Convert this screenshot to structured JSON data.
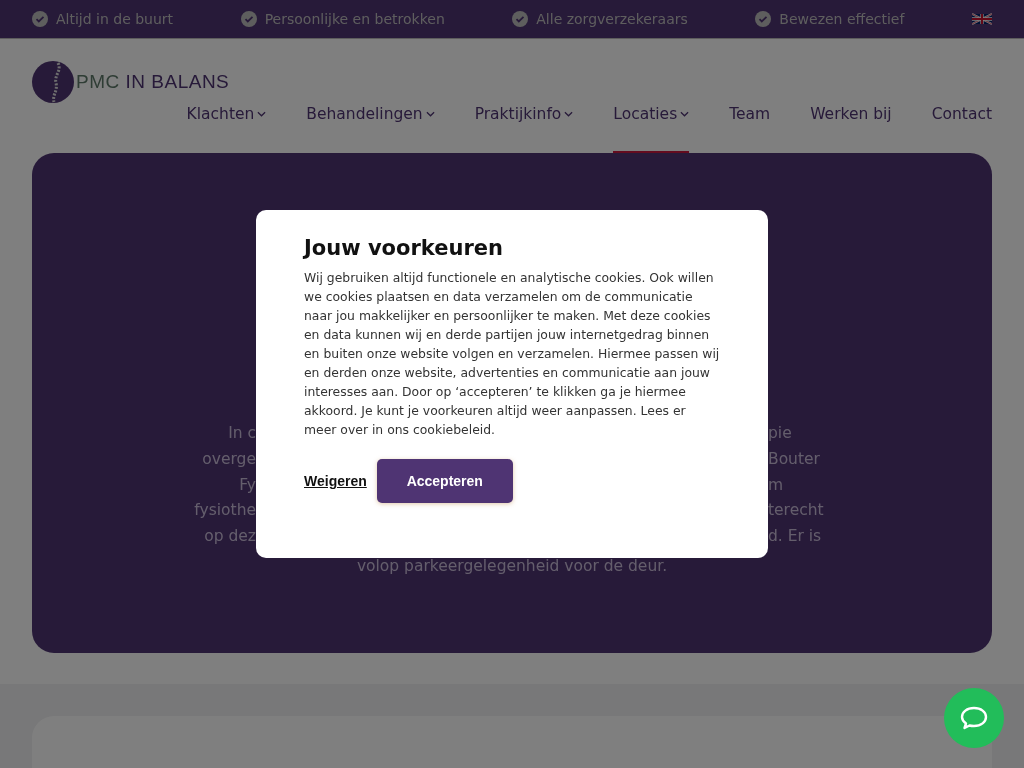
{
  "top_bar": {
    "usps": [
      "Altijd in de buurt",
      "Persoonlijke en betrokken",
      "Alle zorgverzekeraars",
      "Bewezen effectief"
    ]
  },
  "logo": {
    "prefix": "PMC",
    "name": "IN BALANS"
  },
  "nav": [
    {
      "label": "Klachten",
      "dropdown": true,
      "selected": false
    },
    {
      "label": "Behandelingen",
      "dropdown": true,
      "selected": false
    },
    {
      "label": "Praktijkinfo",
      "dropdown": true,
      "selected": false
    },
    {
      "label": "Locaties",
      "dropdown": true,
      "selected": true
    },
    {
      "label": "Team",
      "dropdown": false,
      "selected": false
    },
    {
      "label": "Werken bij",
      "dropdown": false,
      "selected": false
    },
    {
      "label": "Contact",
      "dropdown": false,
      "selected": false
    }
  ],
  "hero": {
    "lines": [
      {
        "left": "In c",
        "right": "pie"
      },
      {
        "left": "overge",
        "right": "Bouter"
      },
      {
        "left": "Fy",
        "right": "m"
      },
      {
        "left": "fysiothe",
        "right": "terecht"
      },
      {
        "left": "op dez",
        "right": "d. Er is"
      }
    ],
    "last_line": "volop parkeergelegenheid voor de deur."
  },
  "cookie_dialog": {
    "title": "Jouw voorkeuren",
    "body": "Wij gebruiken altijd functionele en analytische cookies. Ook willen we cookies plaatsen en data verzamelen om de communicatie naar jou makkelijker en persoonlijker te maken. Met deze cookies en data kunnen wij en derde partijen jouw internetgedrag binnen en buiten onze website volgen en verzamelen. Hiermee passen wij en derden onze website, advertenties en communicatie aan jouw interesses aan. Door op ‘accepteren’ te klikken ga je hiermee akkoord. Je kunt je voorkeuren altijd weer aanpassen. Lees er meer over in ons cookiebeleid.",
    "decline": "Weigeren",
    "accept": "Accepteren"
  }
}
